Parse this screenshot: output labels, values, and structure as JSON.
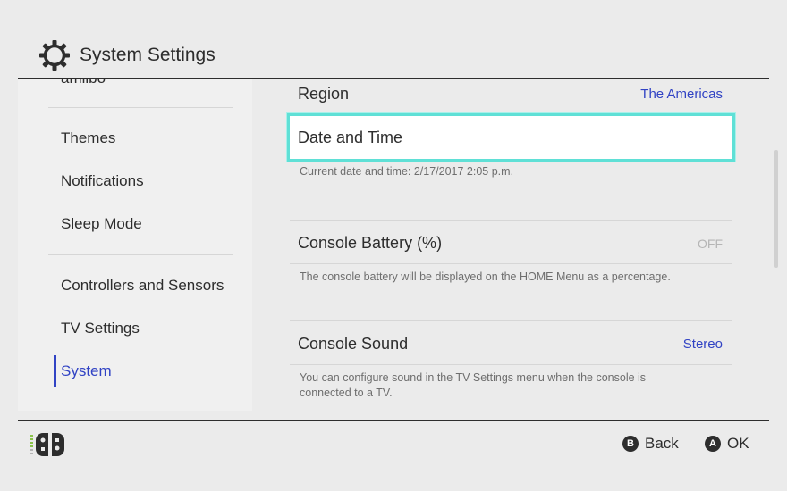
{
  "header": {
    "title": "System Settings"
  },
  "sidebar": {
    "items": [
      {
        "label": "amiibo"
      },
      {
        "label": "Themes"
      },
      {
        "label": "Notifications"
      },
      {
        "label": "Sleep Mode"
      },
      {
        "label": "Controllers and Sensors"
      },
      {
        "label": "TV Settings"
      },
      {
        "label": "System"
      }
    ],
    "active": "System"
  },
  "content": {
    "region": {
      "label": "Region",
      "value": "The Americas"
    },
    "date_time": {
      "label": "Date and Time",
      "desc": "Current date and time: 2/17/2017 2:05 p.m."
    },
    "battery": {
      "label": "Console Battery (%)",
      "value": "OFF",
      "desc": "The console battery will be displayed on the HOME Menu as a percentage."
    },
    "sound": {
      "label": "Console Sound",
      "value": "Stereo",
      "desc": "You can configure sound in the TV Settings menu when the console is connected to a TV."
    }
  },
  "footer": {
    "back": {
      "key": "B",
      "label": "Back"
    },
    "ok": {
      "key": "A",
      "label": "OK"
    }
  },
  "colors": {
    "accent": "#3143c4",
    "selection": "#5fe0d6",
    "background": "#ebebeb"
  }
}
